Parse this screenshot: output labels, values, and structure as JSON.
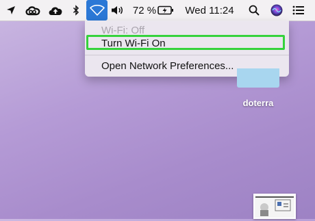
{
  "menubar": {
    "battery_percent": "72 %",
    "clock": "Wed 11:24",
    "icons": [
      "location-icon",
      "creative-cloud-icon",
      "cloud-upload-icon",
      "bluetooth-icon",
      "wifi-icon",
      "volume-icon",
      "battery-icon",
      "search-icon",
      "siri-icon",
      "notification-center-icon"
    ],
    "wifi_highlight_color": "#2b78d6"
  },
  "wifi_menu": {
    "status": "Wi-Fi: Off",
    "turn_on": "Turn Wi-Fi On",
    "preferences": "Open Network Preferences...",
    "highlight_color": "#35d23c"
  },
  "desktop": {
    "folder_label": "doterra"
  }
}
